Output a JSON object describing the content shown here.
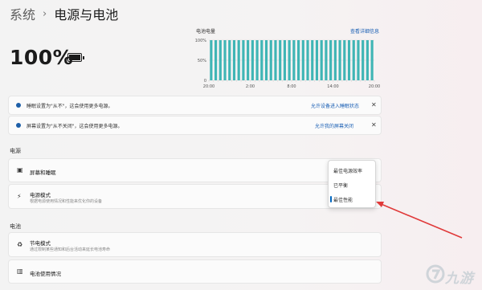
{
  "breadcrumb": {
    "parent": "系统",
    "separator": "›",
    "current": "电源与电池"
  },
  "battery": {
    "percent": "100%",
    "charge_level": 1.0
  },
  "chart_header": {
    "title": "电池电量",
    "link": "查看详细信息"
  },
  "chart_data": {
    "type": "bar",
    "title": "电池电量",
    "y_ticks": [
      "100%",
      "50%",
      "0"
    ],
    "x_ticks": [
      "20:00",
      "2:00",
      "8:00",
      "14:00",
      "20:00"
    ],
    "ylim": [
      0,
      100
    ],
    "bar_count": 36,
    "values": [
      100,
      100,
      100,
      100,
      100,
      100,
      100,
      100,
      100,
      100,
      100,
      100,
      100,
      100,
      100,
      100,
      100,
      100,
      100,
      100,
      100,
      100,
      100,
      100,
      100,
      100,
      100,
      100,
      100,
      100,
      100,
      100,
      100,
      100,
      100,
      100
    ],
    "bar_color": "#3fb5b5"
  },
  "notices": [
    {
      "text": "睡眠设置为\"从不\"，这会使用更多电源。",
      "link": "允许设备进入睡眠状态",
      "close": "✕"
    },
    {
      "text": "屏幕设置为\"从不关闭\"，这会使用更多电源。",
      "link": "允许我的屏幕关闭",
      "close": "✕"
    }
  ],
  "sections": {
    "power": "电源",
    "battery": "电池"
  },
  "rows": {
    "screen_sleep": {
      "title": "屏幕和睡眠",
      "icon": "screen-sleep-icon"
    },
    "power_mode": {
      "title": "电源模式",
      "subtitle": "根据电源使用情况和性能来优化你的设备",
      "icon": "power-mode-icon"
    },
    "saver": {
      "title": "节电模式",
      "subtitle": "通过限制某些通知和后台活动来延长电池寿命",
      "icon": "battery-saver-icon"
    },
    "usage": {
      "title": "电池使用情况",
      "icon": "usage-chart-icon"
    }
  },
  "power_mode_menu": {
    "options": [
      "最佳电源效率",
      "已平衡",
      "最佳性能"
    ],
    "selected": "最佳性能"
  },
  "annotation": {
    "arrow_color": "#e03a3a"
  },
  "colors": {
    "accent": "#0067c0",
    "info": "#1d5fa8",
    "bar": "#3fb5b5"
  }
}
